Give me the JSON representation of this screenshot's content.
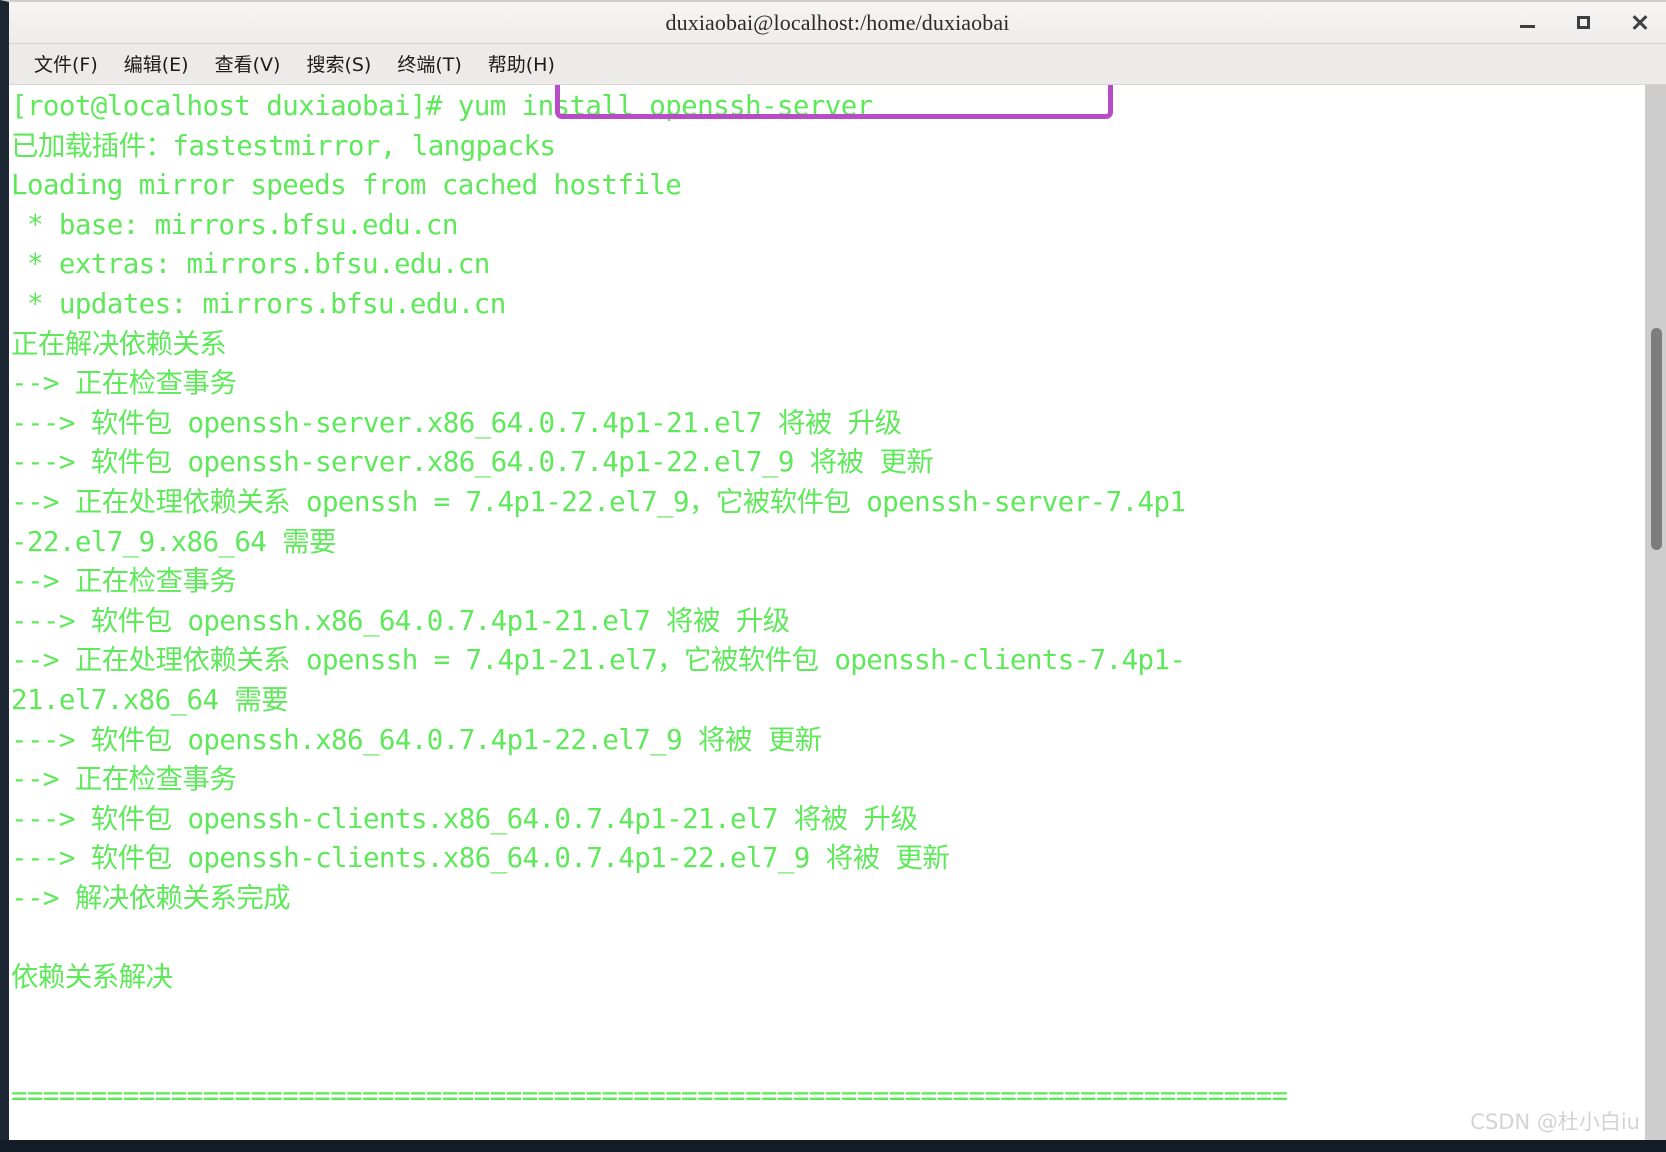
{
  "window": {
    "title": "duxiaobai@localhost:/home/duxiaobai",
    "controls": {
      "minimize": "minimize",
      "maximize": "maximize",
      "close": "close"
    }
  },
  "menubar": {
    "items": [
      {
        "label": "文件(F)"
      },
      {
        "label": "编辑(E)"
      },
      {
        "label": "查看(V)"
      },
      {
        "label": "搜索(S)"
      },
      {
        "label": "终端(T)"
      },
      {
        "label": "帮助(H)"
      }
    ]
  },
  "terminal": {
    "prompt": "[root@localhost duxiaobai]# ",
    "command": "yum install openssh-server",
    "highlight_color": "#b84cc6",
    "text_color": "#5ee85a",
    "background_color": "#ffffff",
    "lines": [
      "已加载插件：fastestmirror, langpacks",
      "Loading mirror speeds from cached hostfile",
      " * base: mirrors.bfsu.edu.cn",
      " * extras: mirrors.bfsu.edu.cn",
      " * updates: mirrors.bfsu.edu.cn",
      "正在解决依赖关系",
      "--> 正在检查事务",
      "---> 软件包 openssh-server.x86_64.0.7.4p1-21.el7 将被 升级",
      "---> 软件包 openssh-server.x86_64.0.7.4p1-22.el7_9 将被 更新",
      "--> 正在处理依赖关系 openssh = 7.4p1-22.el7_9，它被软件包 openssh-server-7.4p1",
      "-22.el7_9.x86_64 需要",
      "--> 正在检查事务",
      "---> 软件包 openssh.x86_64.0.7.4p1-21.el7 将被 升级",
      "--> 正在处理依赖关系 openssh = 7.4p1-21.el7，它被软件包 openssh-clients-7.4p1-",
      "21.el7.x86_64 需要",
      "---> 软件包 openssh.x86_64.0.7.4p1-22.el7_9 将被 更新",
      "--> 正在检查事务",
      "---> 软件包 openssh-clients.x86_64.0.7.4p1-21.el7 将被 升级",
      "---> 软件包 openssh-clients.x86_64.0.7.4p1-22.el7_9 将被 更新",
      "--> 解决依赖关系完成",
      "",
      "依赖关系解决",
      "",
      "",
      "================================================================================"
    ]
  },
  "scrollbar": {
    "name": "vertical-scrollbar"
  },
  "watermark": {
    "text": "CSDN @杜小白iu"
  }
}
